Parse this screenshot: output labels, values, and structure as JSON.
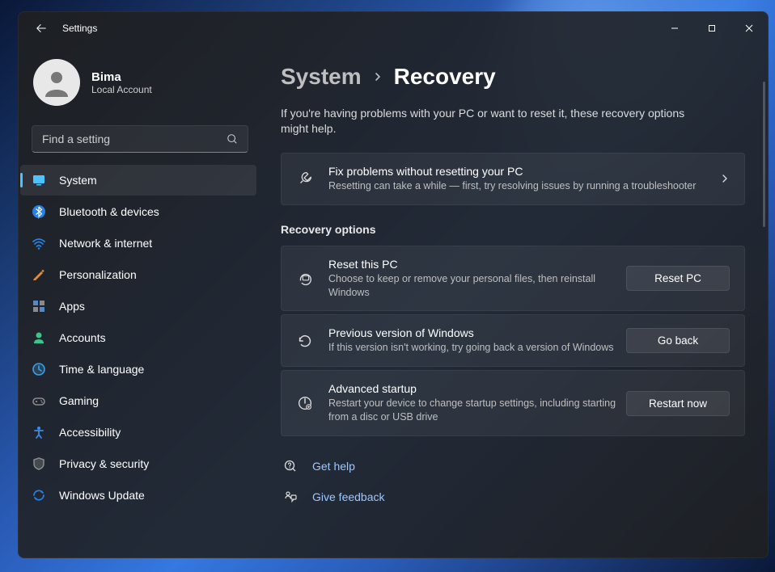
{
  "window": {
    "title": "Settings"
  },
  "profile": {
    "name": "Bima",
    "subtitle": "Local Account"
  },
  "search": {
    "placeholder": "Find a setting"
  },
  "nav": [
    {
      "label": "System",
      "active": true,
      "iconColor": "#4cc2ff"
    },
    {
      "label": "Bluetooth & devices",
      "active": false,
      "iconColor": "#2780e3"
    },
    {
      "label": "Network & internet",
      "active": false,
      "iconColor": "#2780e3"
    },
    {
      "label": "Personalization",
      "active": false,
      "iconColor": "#e3893c"
    },
    {
      "label": "Apps",
      "active": false,
      "iconColor": "#5488c7"
    },
    {
      "label": "Accounts",
      "active": false,
      "iconColor": "#3cc48c"
    },
    {
      "label": "Time & language",
      "active": false,
      "iconColor": "#3ca0e6"
    },
    {
      "label": "Gaming",
      "active": false,
      "iconColor": "#8a8a8a"
    },
    {
      "label": "Accessibility",
      "active": false,
      "iconColor": "#3c8ce6"
    },
    {
      "label": "Privacy & security",
      "active": false,
      "iconColor": "#8a8a8a"
    },
    {
      "label": "Windows Update",
      "active": false,
      "iconColor": "#2780e3"
    }
  ],
  "breadcrumb": {
    "parent": "System",
    "current": "Recovery"
  },
  "description": "If you're having problems with your PC or want to reset it, these recovery options might help.",
  "troubleshoot": {
    "title": "Fix problems without resetting your PC",
    "subtitle": "Resetting can take a while — first, try resolving issues by running a troubleshooter"
  },
  "recovery_section_label": "Recovery options",
  "recovery_cards": [
    {
      "title": "Reset this PC",
      "subtitle": "Choose to keep or remove your personal files, then reinstall Windows",
      "button": "Reset PC"
    },
    {
      "title": "Previous version of Windows",
      "subtitle": "If this version isn't working, try going back a version of Windows",
      "button": "Go back"
    },
    {
      "title": "Advanced startup",
      "subtitle": "Restart your device to change startup settings, including starting from a disc or USB drive",
      "button": "Restart now"
    }
  ],
  "footer_links": [
    {
      "label": "Get help"
    },
    {
      "label": "Give feedback"
    }
  ]
}
